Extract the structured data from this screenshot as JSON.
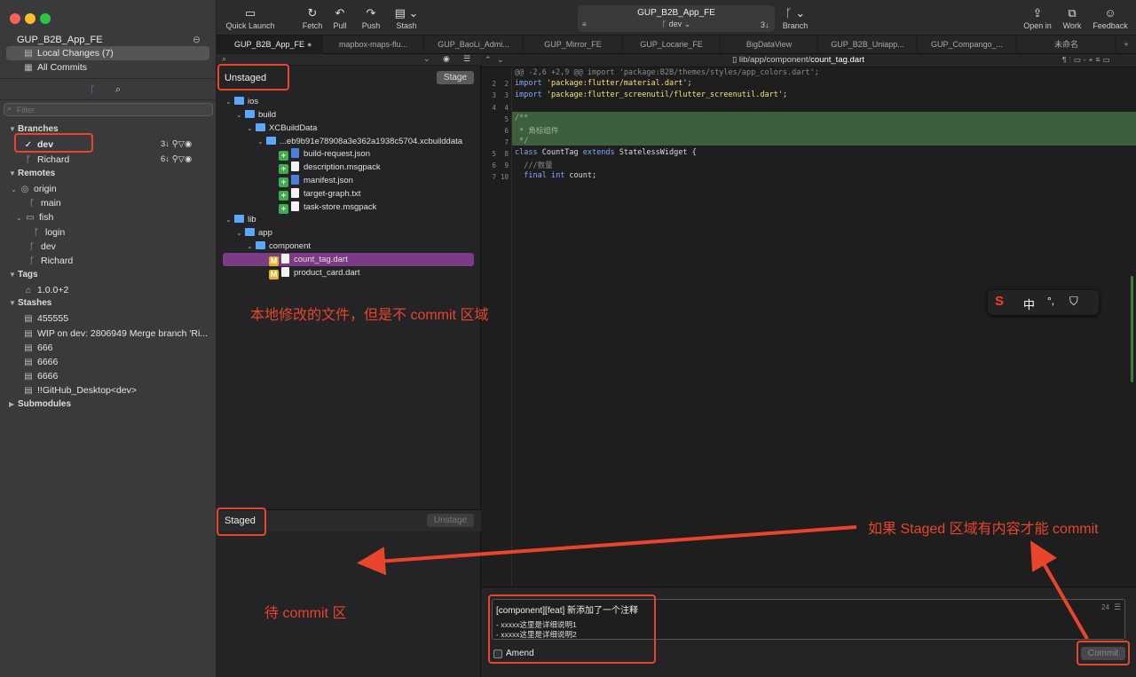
{
  "sidebar": {
    "repo_name": "GUP_B2B_App_FE",
    "local_changes": "Local Changes (7)",
    "all_commits": "All Commits",
    "filter_placeholder": "Filter",
    "branches_header": "Branches",
    "branches": [
      {
        "name": "dev",
        "count": "3↓"
      },
      {
        "name": "Richard",
        "count": "6↓"
      }
    ],
    "remotes_header": "Remotes",
    "remote_origin": "origin",
    "remote_main": "main",
    "remote_fish": "fish",
    "remote_login": "login",
    "remote_dev": "dev",
    "remote_richard": "Richard",
    "tags_header": "Tags",
    "tag_1": "1.0.0+2",
    "stashes_header": "Stashes",
    "stashes": [
      "455555",
      "WIP on dev: 2806949 Merge branch 'Ri...",
      "666",
      "6666",
      "6666",
      "!!GitHub_Desktop<dev>"
    ],
    "submodules_header": "Submodules"
  },
  "toolbar": {
    "quick_launch": "Quick Launch",
    "fetch": "Fetch",
    "pull": "Pull",
    "push": "Push",
    "stash": "Stash",
    "repo_title": "GUP_B2B_App_FE",
    "branch_name": "dev",
    "behind_count": "3↓",
    "branch": "Branch",
    "open_in": "Open in",
    "work": "Work",
    "feedback": "Feedback"
  },
  "tabs": [
    "GUP_B2B_App_FE",
    "mapbox-maps-flu...",
    "GUP_BaoLi_Admi...",
    "GUP_Mirror_FE",
    "GUP_Locarie_FE",
    "BigDataView",
    "GUP_B2B_Uniapp...",
    "GUP_Compango_...",
    "未命名"
  ],
  "unstaged": {
    "title": "Unstaged",
    "stage_button": "Stage",
    "tree": {
      "ios": "ios",
      "build": "build",
      "xcbuilddata": "XCBuildData",
      "hashfolder": "...eb9b91e78908a3e362a1938c5704.xcbuilddata",
      "file1": "build-request.json",
      "file2": "description.msgpack",
      "file3": "manifest.json",
      "file4": "target-graph.txt",
      "file5": "task-store.msgpack",
      "lib": "lib",
      "app": "app",
      "component": "component",
      "count_tag": "count_tag.dart",
      "product_card": "product_card.dart"
    }
  },
  "staged": {
    "title": "Staged",
    "unstage_button": "Unstage"
  },
  "diff": {
    "path_prefix": "lib/app/component/",
    "path_file": "count_tag.dart",
    "hunk_header": "@@ -2,6 +2,9 @@ import 'package:B2B/themes/styles/app_colors.dart';",
    "lines": [
      {
        "old": "2",
        "new": "2",
        "text": "import 'package:flutter/material.dart';"
      },
      {
        "old": "3",
        "new": "3",
        "text": "import 'package:flutter_screenutil/flutter_screenutil.dart';"
      },
      {
        "old": "4",
        "new": "4",
        "text": ""
      },
      {
        "old": "",
        "new": "5",
        "text": "/**"
      },
      {
        "old": "",
        "new": "6",
        "text": " * 角标组件"
      },
      {
        "old": "",
        "new": "7",
        "text": " */"
      },
      {
        "old": "5",
        "new": "8",
        "text": "class CountTag extends StatelessWidget {"
      },
      {
        "old": "6",
        "new": "9",
        "text": "  ///数量"
      },
      {
        "old": "7",
        "new": "10",
        "text": "  final int count;"
      }
    ]
  },
  "commit": {
    "summary": "[component][feat] 新添加了一个注释",
    "description_1": "- xxxxx这里是详细说明1",
    "description_2": "- xxxxx这里是详细说明2",
    "char_count": "24",
    "amend_label": "Amend",
    "commit_button": "Commit"
  },
  "ime": {
    "zh": "中",
    "punct": "°,"
  },
  "annotations": {
    "unstaged_note": "本地修改的文件，但是不 commit 区域",
    "staged_note": "待 commit 区",
    "commit_note": "如果 Staged 区域有内容才能 commit"
  },
  "colors": {
    "annotation_red": "#e8452c",
    "selected_row": "#7b3b85",
    "added_bg": "#3d5f3d",
    "badge_added": "#3fae4a",
    "badge_modified": "#e6b422"
  }
}
